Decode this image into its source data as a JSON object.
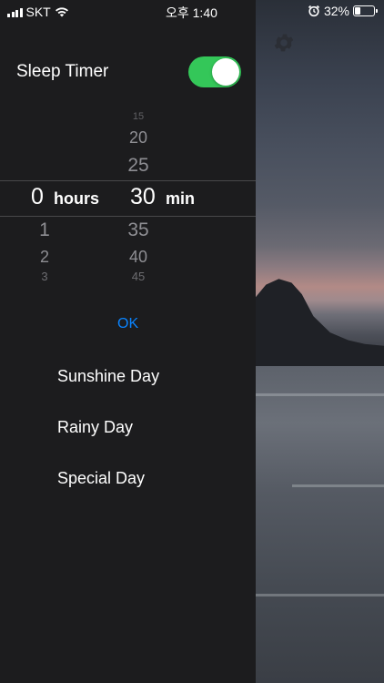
{
  "status": {
    "carrier": "SKT",
    "time": "오후 1:40",
    "battery_percent": "32%",
    "battery_level": 0.32
  },
  "sleep_timer": {
    "label": "Sleep Timer",
    "enabled": true
  },
  "picker": {
    "hours_above": [],
    "hours_selected": "0",
    "hours_unit": "hours",
    "hours_below": [
      "1",
      "2",
      "3"
    ],
    "min_above": [
      "15",
      "20",
      "25"
    ],
    "min_selected": "30",
    "min_unit": "min",
    "min_below": [
      "35",
      "40",
      "45"
    ]
  },
  "ok_label": "OK",
  "days": [
    {
      "label": "Sunshine Day"
    },
    {
      "label": "Rainy Day"
    },
    {
      "label": "Special Day"
    }
  ],
  "colors": {
    "accent": "#0a84ff",
    "toggle_on": "#34c759",
    "panel_bg": "#1c1c1e"
  }
}
